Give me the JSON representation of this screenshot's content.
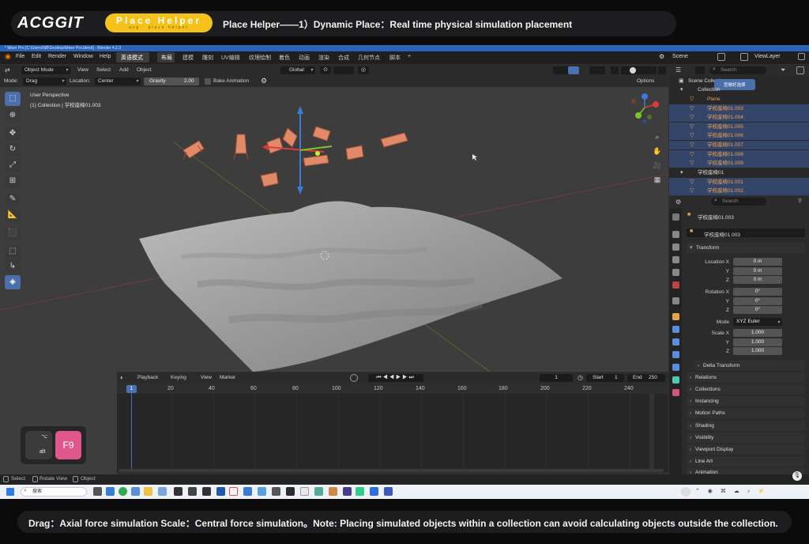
{
  "banner": {
    "logo": "ACGGIT",
    "pill_label": "Place Helper",
    "pill_sub": "acg · place helper",
    "title": "Place Helper——1）Dynamic Place：Real time physical simulation placement"
  },
  "window": {
    "title": "* Mixer Pro [C:\\Users\\NB\\Desktop\\Mixer Pro.blend] - Blender 4.2.3"
  },
  "menubar": {
    "items": [
      "File",
      "Edit",
      "Render",
      "Window",
      "Help"
    ],
    "active_tab": "英语模式",
    "workspaces": [
      "布局",
      "建模",
      "雕刻",
      "UV编辑",
      "纹理绘制",
      "着色",
      "动画",
      "渲染",
      "合成",
      "几何节点",
      "脚本",
      "+"
    ],
    "active_workspace": "布局",
    "scene": "Scene",
    "view_layer": "ViewLayer"
  },
  "viewport_header": {
    "mode": "Object Mode",
    "menus": [
      "View",
      "Select",
      "Add",
      "Object"
    ],
    "orientation": "Global",
    "options": "Options"
  },
  "tool_settings": {
    "mode_label": "Mode:",
    "mode_value": "Drag",
    "location_label": "Location:",
    "location_value": "Center",
    "gravity_label": "Gravity",
    "gravity_value": "2.00",
    "bake_animation": "Bake Animation"
  },
  "viewport": {
    "perspective": "User Perspective",
    "collection_info": "(1) Collection | 学校座椅01.003"
  },
  "timeline": {
    "menus": [
      "Playback",
      "Keying",
      "View",
      "Marker"
    ],
    "current_frame": "1",
    "start_label": "Start",
    "start_value": "1",
    "end_label": "End",
    "end_value": "250",
    "ruler": [
      "1",
      "20",
      "40",
      "60",
      "80",
      "100",
      "120",
      "140",
      "160",
      "180",
      "200",
      "220",
      "240"
    ]
  },
  "key_overlay": {
    "modifier_symbol": "⌥",
    "modifier": "alt",
    "key": "F9"
  },
  "statusbar": {
    "items": [
      "Select",
      "Rotate View",
      "Object"
    ]
  },
  "outliner": {
    "search_placeholder": "Search",
    "tooltip": "您做好选择",
    "rows": [
      {
        "name": "Scene Collection"
      },
      {
        "name": "Collection"
      },
      {
        "name": "Plane"
      },
      {
        "name": "学校座椅01.003"
      },
      {
        "name": "学校座椅01.004"
      },
      {
        "name": "学校座椅01.005"
      },
      {
        "name": "学校座椅01.006"
      },
      {
        "name": "学校座椅01.007"
      },
      {
        "name": "学校座椅01.008"
      },
      {
        "name": "学校座椅01.009"
      },
      {
        "name": "学校座椅01"
      },
      {
        "name": "学校座椅01.001"
      },
      {
        "name": "学校座椅01.002"
      }
    ]
  },
  "properties": {
    "search_placeholder": "Search",
    "object_header": "学校座椅01.003",
    "object_name": "学校座椅01.003",
    "transform": "Transform",
    "location_x_label": "Location X",
    "location_x": "0 m",
    "y_label": "Y",
    "z_label": "Z",
    "location_y": "0 m",
    "location_z": "0 m",
    "rotation_x_label": "Rotation X",
    "rotation_x": "0°",
    "rotation_y": "0°",
    "rotation_z": "0°",
    "mode_label": "Mode",
    "mode_value": "XYZ Euler",
    "scale_x_label": "Scale X",
    "scale_x": "1.000",
    "scale_y": "1.000",
    "scale_z": "1.000",
    "delta_transform": "Delta Transform",
    "panels": [
      "Relations",
      "Collections",
      "Instancing",
      "Motion Paths",
      "Shading",
      "Visibility",
      "Viewport Display",
      "Line Art",
      "Animation"
    ]
  },
  "taskbar": {
    "search": "搜索"
  },
  "caption": "Drag：Axial force simulation Scale：Central force simulation。Note: Placing simulated objects within a collection can avoid calculating objects outside the collection."
}
